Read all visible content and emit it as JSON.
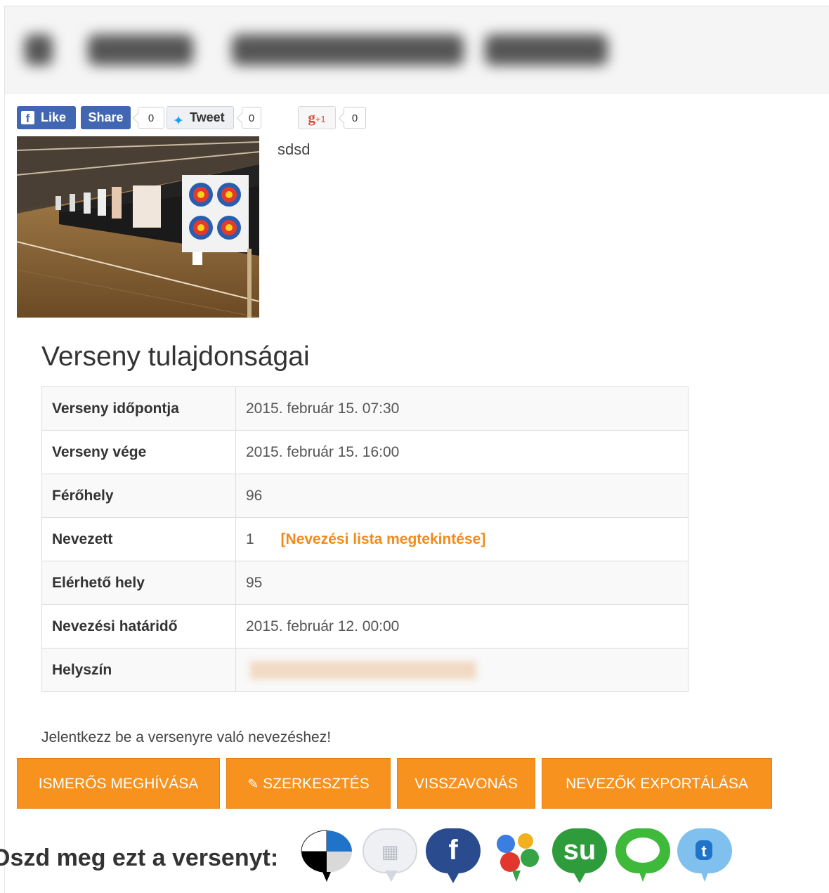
{
  "social": {
    "like_label": "Like",
    "share_label": "Share",
    "share_count": "0",
    "tweet_label": "Tweet",
    "tweet_count": "0",
    "gplus_label": "+1",
    "gplus_count": "0"
  },
  "event": {
    "description": "sdsd"
  },
  "properties": {
    "title": "Verseny tulajdonságai",
    "rows": [
      {
        "label": "Verseny időpontja",
        "value": "2015. február 15. 07:30"
      },
      {
        "label": "Verseny vége",
        "value": "2015. február 15. 16:00"
      },
      {
        "label": "Férőhely",
        "value": "96"
      },
      {
        "label": "Nevezett",
        "value": "1",
        "link": "[Nevezési lista megtekintése]"
      },
      {
        "label": "Elérhető hely",
        "value": "95"
      },
      {
        "label": "Nevezési határidő",
        "value": "2015. február 12. 00:00"
      },
      {
        "label": "Helyszín",
        "value": ""
      }
    ]
  },
  "login_note": "Jelentkezz be a versenyre való nevezéshez!",
  "actions": {
    "invite": "ISMERŐS MEGHÍVÁSA",
    "edit": "SZERKESZTÉS",
    "withdraw": "VISSZAVONÁS",
    "export": "NEVEZŐK EXPORTÁLÁSA"
  },
  "share": {
    "label": "Oszd meg ezt a versenyt:",
    "icons": [
      "delicious-icon",
      "digg-icon",
      "facebook-icon",
      "google-icon",
      "stumbleupon-icon",
      "chat-icon",
      "twitter-icon"
    ]
  },
  "colors": {
    "accent": "#f7921e",
    "link": "#f08a1c",
    "facebook": "#4267b2",
    "twitter": "#1da1f2"
  }
}
